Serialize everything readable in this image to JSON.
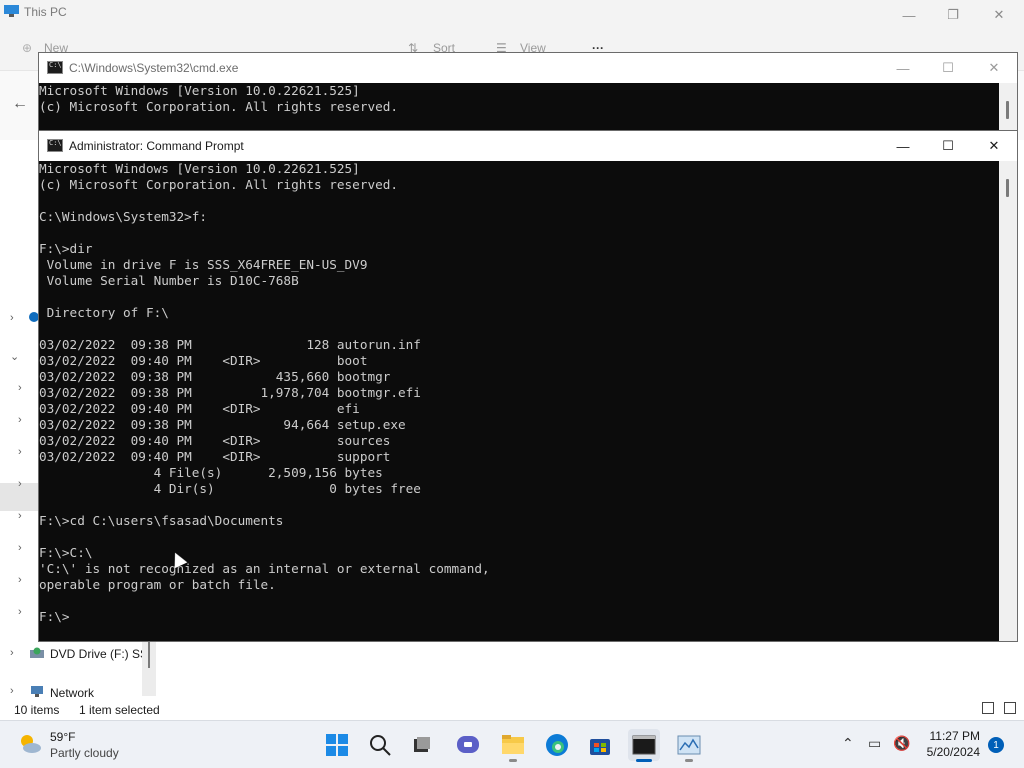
{
  "explorer": {
    "title": "This PC",
    "toolbar": {
      "new_label": "New",
      "sort_label": "Sort",
      "view_label": "View",
      "more_label": "···"
    },
    "nav": {
      "items": [
        {
          "label": "DVD Drive (F:) SS",
          "icon": "dvd-drive-icon"
        },
        {
          "label": "Network",
          "icon": "network-icon"
        }
      ]
    },
    "status": {
      "item_count": "10 items",
      "selection": "1 item selected"
    }
  },
  "console_back": {
    "title": "C:\\Windows\\System32\\cmd.exe",
    "lines": [
      "Microsoft Windows [Version 10.0.22621.525]",
      "(c) Microsoft Corporation. All rights reserved."
    ]
  },
  "console_front": {
    "title": "Administrator: Command Prompt",
    "lines": [
      "Microsoft Windows [Version 10.0.22621.525]",
      "(c) Microsoft Corporation. All rights reserved.",
      "",
      "C:\\Windows\\System32>f:",
      "",
      "F:\\>dir",
      " Volume in drive F is SSS_X64FREE_EN-US_DV9",
      " Volume Serial Number is D10C-768B",
      "",
      " Directory of F:\\",
      "",
      "03/02/2022  09:38 PM               128 autorun.inf",
      "03/02/2022  09:40 PM    <DIR>          boot",
      "03/02/2022  09:38 PM           435,660 bootmgr",
      "03/02/2022  09:38 PM         1,978,704 bootmgr.efi",
      "03/02/2022  09:40 PM    <DIR>          efi",
      "03/02/2022  09:38 PM            94,664 setup.exe",
      "03/02/2022  09:40 PM    <DIR>          sources",
      "03/02/2022  09:40 PM    <DIR>          support",
      "               4 File(s)      2,509,156 bytes",
      "               4 Dir(s)               0 bytes free",
      "",
      "F:\\>cd C:\\users\\fsasad\\Documents",
      "",
      "F:\\>C:\\",
      "'C:\\' is not recognized as an internal or external command,",
      "operable program or batch file.",
      "",
      "F:\\>"
    ]
  },
  "taskbar": {
    "weather": {
      "temp": "59°F",
      "desc": "Partly cloudy"
    },
    "apps": [
      "start-icon",
      "search-icon",
      "task-view-icon",
      "teams-chat-icon",
      "file-explorer-icon",
      "edge-icon",
      "store-icon",
      "terminal-icon",
      "monitor-icon"
    ],
    "clock": {
      "time": "11:27 PM",
      "date": "5/20/2024"
    },
    "notification_count": "1"
  },
  "colors": {
    "console_bg": "#0c0c0c",
    "console_text": "#cccccc",
    "accent": "#005fb8",
    "taskbar_bg": "#eef1f6"
  }
}
